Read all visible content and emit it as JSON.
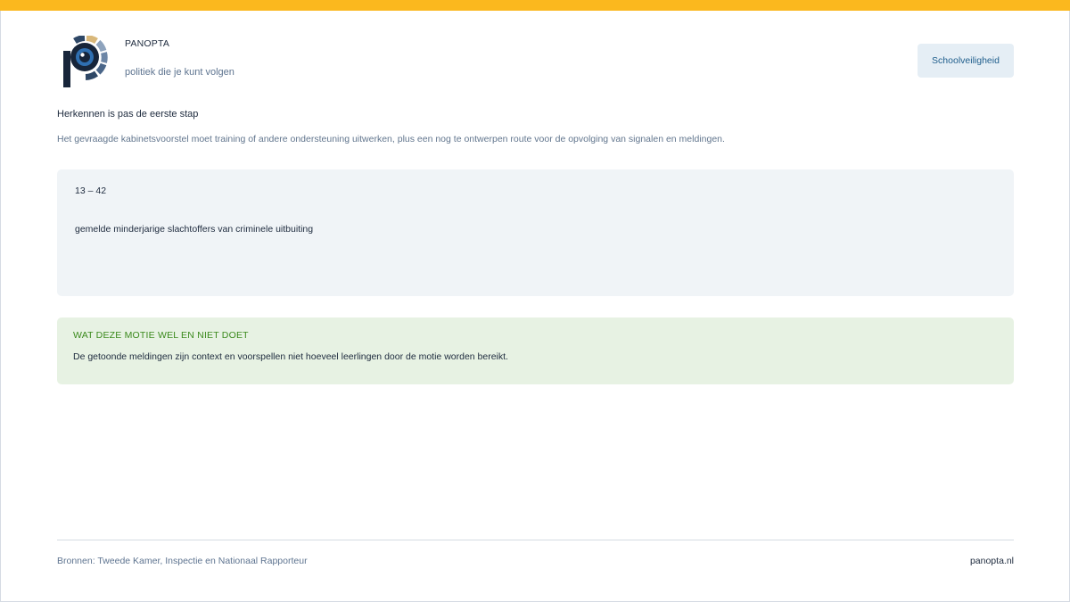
{
  "header": {
    "brand": "PANOPTA",
    "tagline": "politiek die je kunt volgen",
    "topic_button": "Schoolveiligheid"
  },
  "intro": {
    "headline": "Herkennen is pas de eerste stap",
    "subline": "Het gevraagde kabinetsvoorstel moet training of andere ondersteuning uitwerken, plus een nog te ontwerpen route voor de opvolging van signalen en meldingen."
  },
  "stat": {
    "range": "13 – 42",
    "label": "gemelde minderjarige slachtoffers van criminele uitbuiting"
  },
  "note": {
    "title": "WAT DEZE MOTIE WEL EN NIET DOET",
    "text": "De getoonde meldingen zijn context en voorspellen niet hoeveel leerlingen door de motie worden bereikt."
  },
  "footer": {
    "sources": "Bronnen: Tweede Kamer, Inspectie en Nationaal Rapporteur",
    "site": "panopta.nl"
  },
  "colors": {
    "accent_bar": "#fbb81e",
    "navy": "#1d2a3d",
    "note_green": "#3b8a1d",
    "note_bg": "#e7f2e3",
    "stat_bg": "#f0f4f7",
    "topic_bg": "#e5eef5"
  }
}
